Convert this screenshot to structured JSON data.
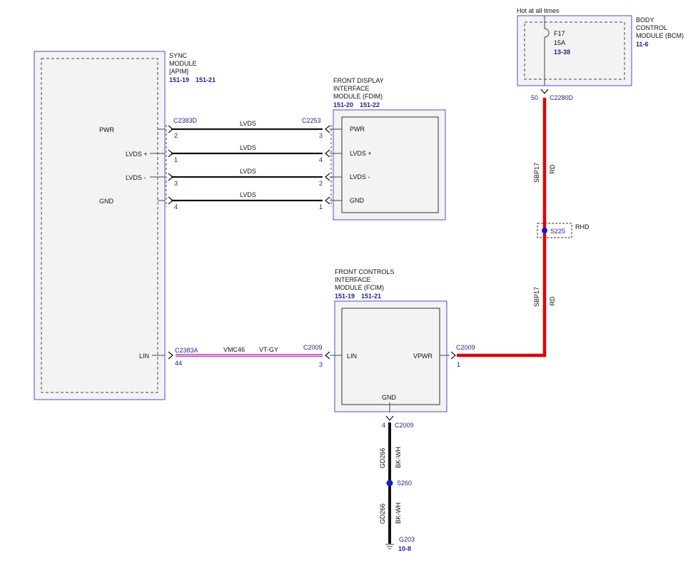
{
  "colors": {
    "power_wire": "#e30000",
    "lin_wire": "#c43cc4",
    "signal_wire": "#111111",
    "module_border": "#6b6bd6",
    "splice_dot": "#0a1ee6",
    "ref_text": "#1f1f9a"
  },
  "hot_label": "Hot at all times",
  "bcm": {
    "title": [
      "BODY",
      "CONTROL",
      "MODULE (BCM)"
    ],
    "ref": "11-6",
    "fuse_id": "F17",
    "fuse_amp": "15A",
    "fuse_ref": "13-38",
    "pin": "50",
    "connector": "C2280D"
  },
  "sync": {
    "title": [
      "SYNC",
      "MODULE",
      "[APIM]"
    ],
    "refs": [
      "151-19",
      "151-21"
    ],
    "pins": [
      {
        "label": "PWR",
        "pin": "2",
        "connector": "C2383D"
      },
      {
        "label": "LVDS +",
        "pin": "1"
      },
      {
        "label": "LVDS -",
        "pin": "3"
      },
      {
        "label": "GND",
        "pin": "4"
      }
    ],
    "lin": {
      "label": "LIN",
      "pin": "44",
      "connector": "C2383A"
    }
  },
  "fdim": {
    "title": [
      "FRONT DISPLAY",
      "INTERFACE",
      "MODULE (FDIM)"
    ],
    "refs": [
      "151-20",
      "151-22"
    ],
    "connector": "C2253",
    "pins": [
      {
        "label": "PWR",
        "pin": "3"
      },
      {
        "label": "LVDS +",
        "pin": "4"
      },
      {
        "label": "LVDS -",
        "pin": "2"
      },
      {
        "label": "GND",
        "pin": "1"
      }
    ]
  },
  "lvds_wires": [
    "LVDS",
    "LVDS",
    "LVDS",
    "LVDS"
  ],
  "fcim": {
    "title": [
      "FRONT CONTROLS",
      "INTERFACE",
      "MODULE (FCIM)"
    ],
    "refs": [
      "151-19",
      "151-21"
    ],
    "lin_label": "LIN",
    "lin_connector": "C2009",
    "lin_pin": "3",
    "vpwr_label": "VPWR",
    "vpwr_connector": "C2009",
    "vpwr_pin": "1",
    "gnd_label": "GND",
    "gnd_pin": "4",
    "gnd_connector": "C2009"
  },
  "lin_wire": {
    "circuit": "VMC46",
    "color": "VT-GY"
  },
  "power_wire": {
    "circuit": "SBP17",
    "color": "RD"
  },
  "splice_s225": {
    "id": "S225",
    "note": "RHD"
  },
  "ground_wire": {
    "circuit": "GD266",
    "color": "BK-WH"
  },
  "splice_s260": {
    "id": "S260"
  },
  "ground": {
    "id": "G203",
    "ref": "10-8"
  }
}
